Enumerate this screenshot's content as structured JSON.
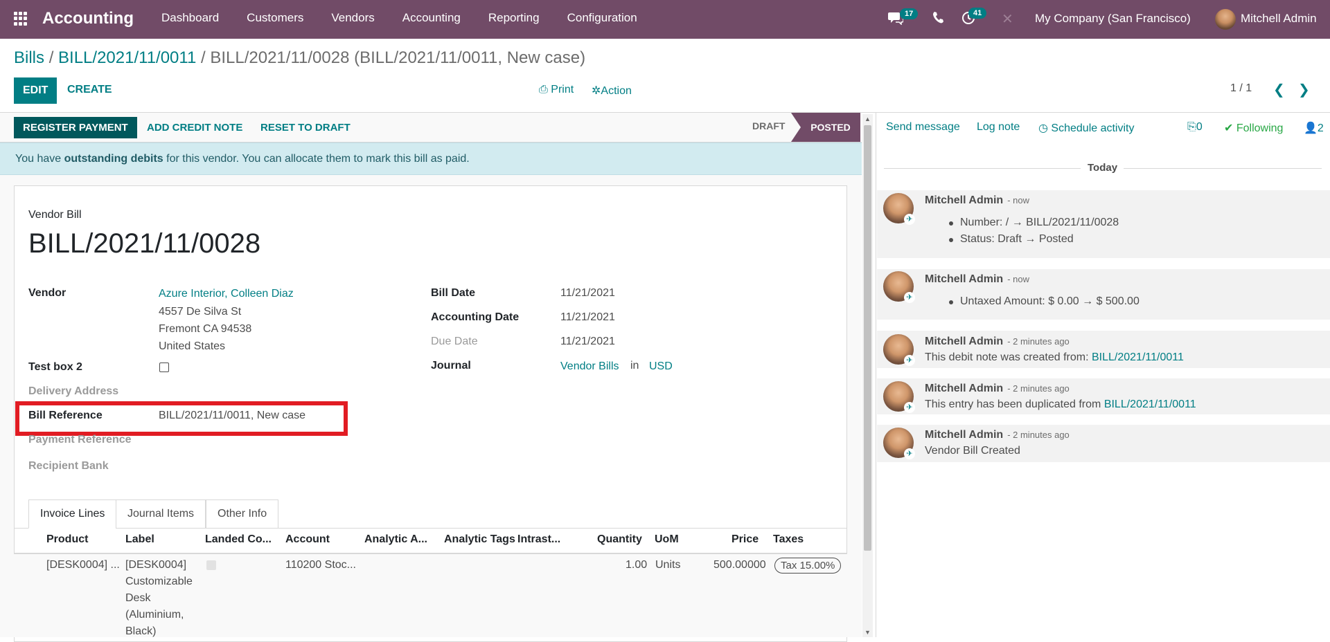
{
  "app": {
    "name": "Accounting"
  },
  "menu": [
    "Dashboard",
    "Customers",
    "Vendors",
    "Accounting",
    "Reporting",
    "Configuration"
  ],
  "systray": {
    "messages_count": "17",
    "activities_count": "41",
    "company": "My Company (San Francisco)",
    "user": "Mitchell Admin"
  },
  "breadcrumb": {
    "root": "Bills",
    "parent": "BILL/2021/11/0011",
    "current": "BILL/2021/11/0028 (BILL/2021/11/0011, New case)",
    "separator": "/"
  },
  "controls": {
    "edit": "EDIT",
    "create": "CREATE",
    "print": "Print",
    "action": "Action",
    "pager": "1 / 1"
  },
  "statusbar": {
    "register_payment": "REGISTER PAYMENT",
    "add_credit_note": "ADD CREDIT NOTE",
    "reset_to_draft": "RESET TO DRAFT",
    "stage_draft": "DRAFT",
    "stage_posted": "POSTED"
  },
  "alert": {
    "prefix": "You have ",
    "bold": "outstanding debits",
    "suffix": " for this vendor. You can allocate them to mark this bill as paid."
  },
  "form": {
    "type_label": "Vendor Bill",
    "number": "BILL/2021/11/0028",
    "vendor_label": "Vendor",
    "vendor_name": "Azure Interior, Colleen Diaz",
    "vendor_street": "4557 De Silva St",
    "vendor_city": "Fremont CA 94538",
    "vendor_country": "United States",
    "testbox_label": "Test box 2",
    "delivery_label": "Delivery Address",
    "billref_label": "Bill Reference",
    "billref_value": "BILL/2021/11/0011, New case",
    "payref_label": "Payment Reference",
    "recipient_label": "Recipient Bank",
    "bill_date_label": "Bill Date",
    "bill_date": "11/21/2021",
    "acc_date_label": "Accounting Date",
    "acc_date": "11/21/2021",
    "due_date_label": "Due Date",
    "due_date": "11/21/2021",
    "journal_label": "Journal",
    "journal": "Vendor Bills",
    "journal_in": "in",
    "currency": "USD"
  },
  "tabs": [
    "Invoice Lines",
    "Journal Items",
    "Other Info"
  ],
  "lines": {
    "headers": [
      "Product",
      "Label",
      "Landed Co...",
      "Account",
      "Analytic A...",
      "Analytic Tags",
      "Intrast...",
      "Quantity",
      "UoM",
      "Price",
      "Taxes"
    ],
    "row": {
      "product": "[DESK0004] ...",
      "label_lines": [
        "[DESK0004]",
        "Customizable",
        "Desk",
        "(Aluminium,",
        "Black)"
      ],
      "account": "110200 Stoc...",
      "quantity": "1.00",
      "uom": "Units",
      "price": "500.00000",
      "tax": "Tax 15.00%"
    }
  },
  "chatter": {
    "send_message": "Send message",
    "log_note": "Log note",
    "schedule_activity": "Schedule activity",
    "attachments": "0",
    "following": "Following",
    "followers": "2",
    "today": "Today",
    "messages": [
      {
        "author": "Mitchell Admin",
        "time": "- now",
        "bullets": [
          "Number: / → BILL/2021/11/0028",
          "Status: Draft → Posted"
        ]
      },
      {
        "author": "Mitchell Admin",
        "time": "- now",
        "bullets": [
          "Untaxed Amount: $ 0.00 → $ 500.00"
        ]
      },
      {
        "author": "Mitchell Admin",
        "time": "- 2 minutes ago",
        "text": "This debit note was created from: ",
        "link": "BILL/2021/11/0011"
      },
      {
        "author": "Mitchell Admin",
        "time": "- 2 minutes ago",
        "text": "This entry has been duplicated from ",
        "link": "BILL/2021/11/0011"
      },
      {
        "author": "Mitchell Admin",
        "time": "- 2 minutes ago",
        "text": "Vendor Bill Created"
      }
    ]
  }
}
